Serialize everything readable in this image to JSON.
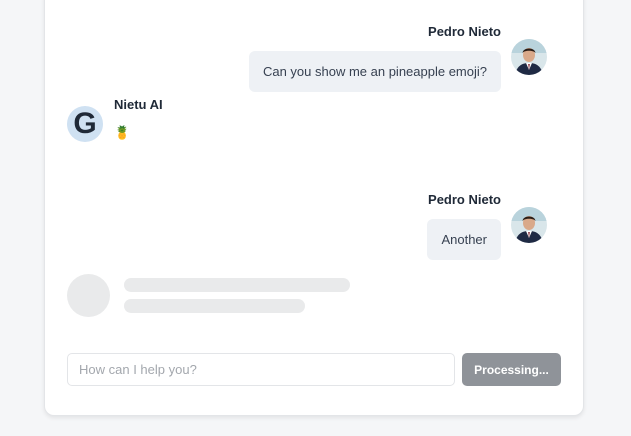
{
  "messages": [
    {
      "role": "user",
      "author": "Pedro Nieto",
      "text": "Can you show me an pineapple emoji?"
    },
    {
      "role": "assistant",
      "author": "Nietu AI",
      "text": "🍍"
    },
    {
      "role": "user",
      "author": "Pedro Nieto",
      "text": "Another"
    }
  ],
  "assistant_avatar_letter": "G",
  "composer": {
    "placeholder": "How can I help you?",
    "value": "",
    "button_label": "Processing..."
  },
  "colors": {
    "assistant_avatar_bg": "#cfe1f2",
    "button_bg": "#8f9399",
    "user_bubble_bg": "#eef1f5"
  },
  "icons": {
    "user_avatar": "profile-photo",
    "assistant_avatar": "g-logo-icon"
  },
  "status": {
    "loading": true
  }
}
